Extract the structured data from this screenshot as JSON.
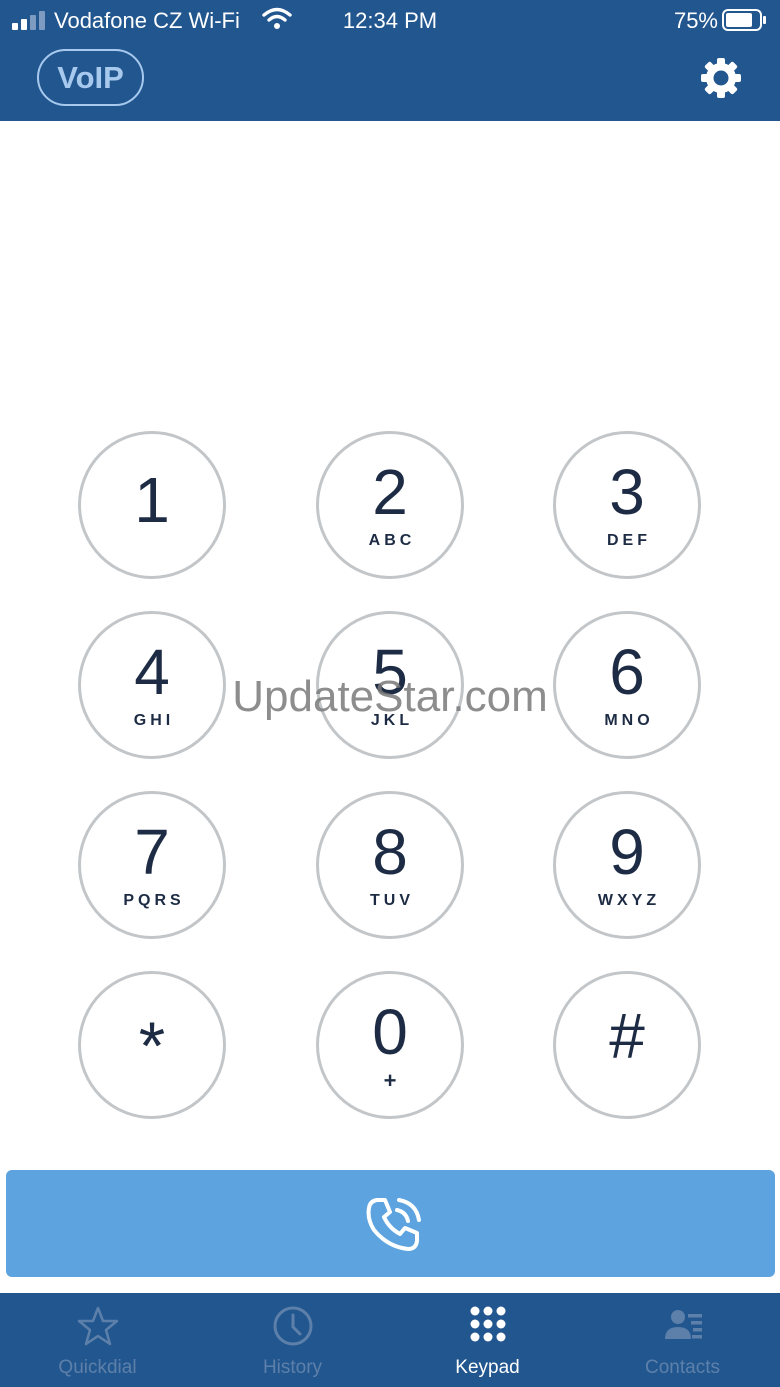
{
  "status_bar": {
    "carrier": "Vodafone CZ Wi-Fi",
    "time": "12:34 PM",
    "battery": "75%"
  },
  "header": {
    "brand": "VoIP",
    "settings_icon": "gear-icon"
  },
  "keypad": {
    "keys": [
      {
        "digit": "1",
        "letters": ""
      },
      {
        "digit": "2",
        "letters": "ABC"
      },
      {
        "digit": "3",
        "letters": "DEF"
      },
      {
        "digit": "4",
        "letters": "GHI"
      },
      {
        "digit": "5",
        "letters": "JKL"
      },
      {
        "digit": "6",
        "letters": "MNO"
      },
      {
        "digit": "7",
        "letters": "PQRS"
      },
      {
        "digit": "8",
        "letters": "TUV"
      },
      {
        "digit": "9",
        "letters": "WXYZ"
      },
      {
        "digit": "*",
        "letters": ""
      },
      {
        "digit": "0",
        "letters": "+"
      },
      {
        "digit": "#",
        "letters": ""
      }
    ]
  },
  "watermark": "UpdateStar.com",
  "call_button": {
    "icon": "phone-call-icon"
  },
  "tabbar": {
    "tabs": [
      {
        "label": "Quickdial",
        "icon": "star-icon",
        "active": false
      },
      {
        "label": "History",
        "icon": "clock-icon",
        "active": false
      },
      {
        "label": "Keypad",
        "icon": "keypad-grid-icon",
        "active": true
      },
      {
        "label": "Contacts",
        "icon": "contact-card-icon",
        "active": false
      }
    ]
  },
  "colors": {
    "header_bg": "#22568f",
    "call_button_bg": "#5da3df",
    "key_border": "#c3c6c9",
    "key_text": "#1d2c44",
    "tab_inactive": "#5d80aa",
    "tab_active": "#ffffff"
  }
}
